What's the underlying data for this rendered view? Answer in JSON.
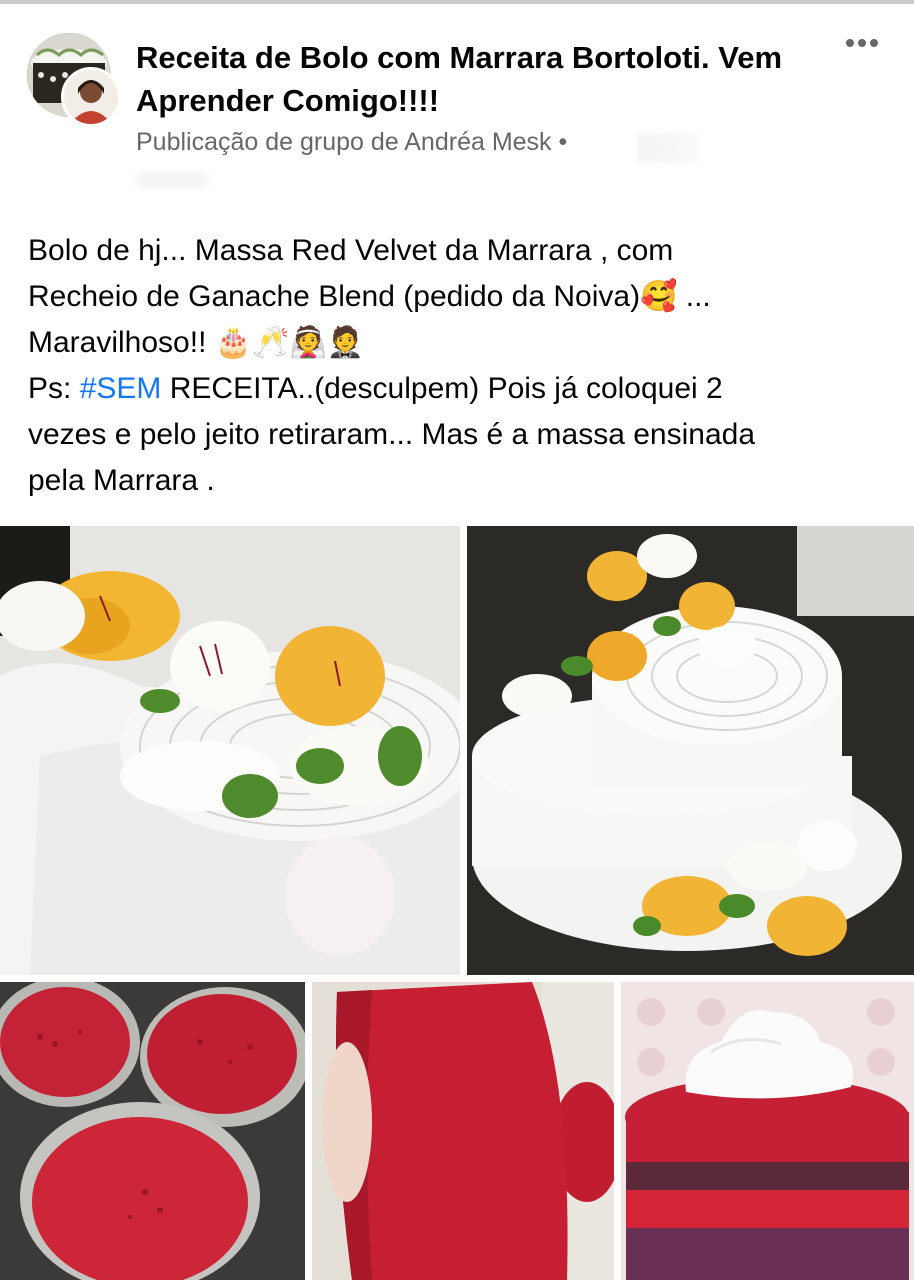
{
  "post": {
    "group_title": "Receita de Bolo com Marrara Bortoloti. Vem Aprender Comigo!!!!",
    "subtitle": "Publicação de grupo de Andréa Mesk •",
    "body_line1": "Bolo de hj... Massa Red Velvet da Marrara , com",
    "body_line2": "Recheio de Ganache Blend (pedido da Noiva)🥰 ...",
    "body_line3": "Maravilhoso!! 🎂🥂👰🤵",
    "body_ps_prefix": "Ps: ",
    "hashtag": "#SEM",
    "body_ps_rest": " RECEITA..(desculpem) Pois já coloquei 2",
    "body_line5": "vezes e pelo jeito retiraram... Mas é a massa ensinada",
    "body_line6": "pela Marrara ."
  },
  "icons": {
    "more": "more-horizontal-icon"
  },
  "colors": {
    "hashtag": "#1877f2",
    "secondary_text": "#65676b",
    "primary_text": "#050505"
  }
}
